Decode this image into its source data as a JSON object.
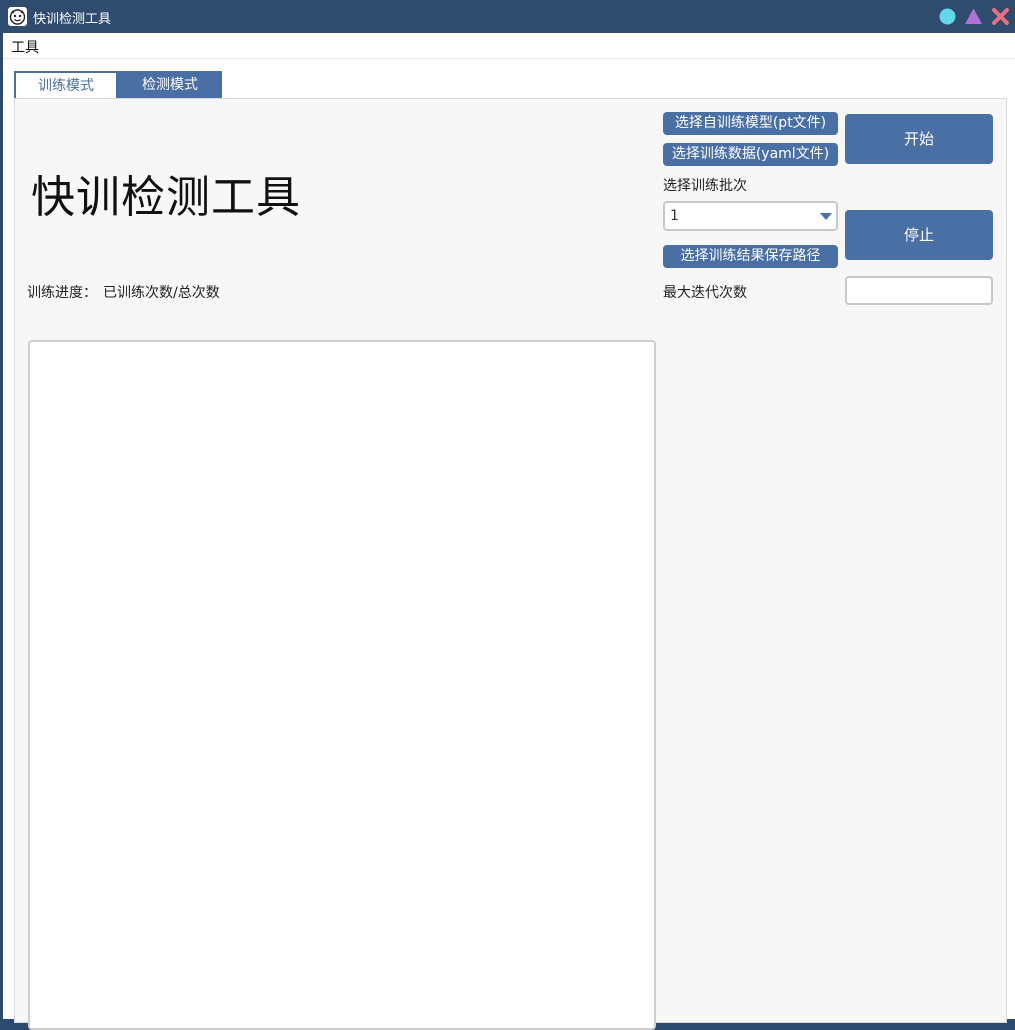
{
  "window": {
    "title": "快训检测工具"
  },
  "menu": {
    "items": [
      {
        "label": "工具"
      }
    ]
  },
  "tabs": [
    {
      "label": "训练模式",
      "active": true
    },
    {
      "label": "检测模式",
      "active": false
    }
  ],
  "main": {
    "heading": "快训检测工具",
    "progress_label": "训练进度：",
    "progress_value": "已训练次数/总次数",
    "log_text": ""
  },
  "controls": {
    "select_model_button": "选择自训练模型(pt文件)",
    "select_data_button": "选择训练数据(yaml文件)",
    "batch_label": "选择训练批次",
    "batch_value": "1",
    "select_save_path_button": "选择训练结果保存路径",
    "max_iter_label": "最大迭代次数",
    "max_iter_value": "",
    "start_button": "开始",
    "stop_button": "停止"
  },
  "colors": {
    "titlebar": "#2f4b6e",
    "accent": "#4a6fa5",
    "panel_bg": "#f7f7f7",
    "min_button": "#63d6e8",
    "max_button": "#b070d8",
    "close_button": "#e87080"
  },
  "icons": {
    "app": "cartoon-face-icon",
    "minimize": "circle-icon",
    "maximize": "triangle-icon",
    "close": "x-icon"
  }
}
